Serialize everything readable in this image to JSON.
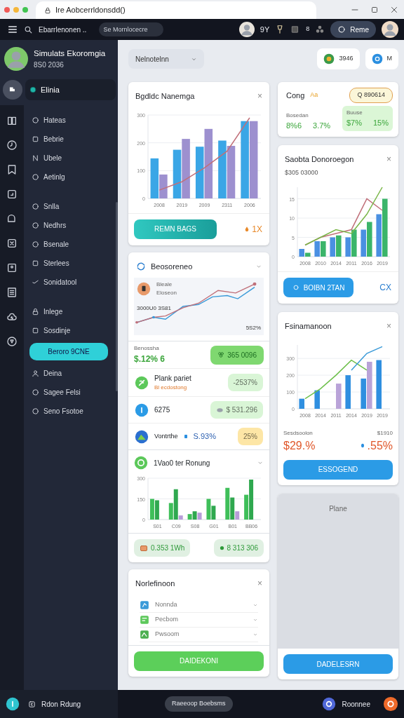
{
  "browser": {
    "tab_title": "Ire Aobcerrldonsdd()"
  },
  "topbar": {
    "search_label": "Ebarrlenonen ..",
    "search": {
      "placeholder": "Se Mornlocecre"
    },
    "counter": "9Y",
    "badge": "8",
    "account_button": "Reme"
  },
  "profile": {
    "name": "Simulats Ekoromgia",
    "subtitle": "8S0 2036"
  },
  "nav_header": {
    "label": "Elinia",
    "selected": true
  },
  "sidebar": {
    "groups": [
      {
        "items": [
          {
            "label": "Hateas",
            "kind": "link",
            "selected": false
          },
          {
            "label": "Bebrie",
            "kind": "link",
            "selected": false
          },
          {
            "label": "Ubele",
            "kind": "link",
            "selected": false
          },
          {
            "label": "Aetinlg",
            "kind": "link",
            "selected": false
          }
        ]
      },
      {
        "items": [
          {
            "label": "Snlla",
            "kind": "link",
            "selected": false
          },
          {
            "label": "Nedhrs",
            "kind": "link",
            "selected": false
          },
          {
            "label": "Bsenale",
            "kind": "link",
            "selected": false
          },
          {
            "label": "Sterlees",
            "kind": "link",
            "selected": false
          },
          {
            "label": "Sonidatool",
            "kind": "link",
            "selected": false
          }
        ]
      },
      {
        "items": [
          {
            "label": "Inlege",
            "kind": "link",
            "selected": false
          },
          {
            "label": "Sosdinje",
            "kind": "link",
            "selected": false
          },
          {
            "label": "Beroro 9CNE",
            "kind": "button",
            "selected": false
          },
          {
            "label": "Deina",
            "kind": "link",
            "selected": false
          },
          {
            "label": "Sagee Felsi",
            "kind": "link",
            "selected": false
          },
          {
            "label": "Seno Fsotoe",
            "kind": "link",
            "selected": false
          }
        ]
      }
    ]
  },
  "filter": {
    "value": "Nelnotelnn"
  },
  "chips": [
    {
      "label": "3946"
    },
    {
      "label": "M"
    }
  ],
  "column_1": [
    {
      "kind": "chart",
      "title": "Bgdldc Nanemga",
      "close": "×",
      "chart_data": {
        "type": "bar",
        "grid": true,
        "categories": [
          "2008",
          "2019",
          "2009",
          "2311",
          "2006"
        ],
        "ylim": [
          0,
          300
        ],
        "yticks": [
          0,
          100,
          200,
          300
        ],
        "series": [
          {
            "type": "bar",
            "color": "#3aa6e6",
            "values": [
              144,
              175,
              186,
              208,
              278
            ]
          },
          {
            "type": "bar",
            "color": "#9d90cf",
            "values": [
              86,
              214,
              250,
              189,
              278
            ]
          },
          {
            "type": "line",
            "color": "#c0707a",
            "values": [
              30,
              60,
              110,
              170,
              290
            ]
          }
        ]
      },
      "button": {
        "label": "REMN BAGS",
        "kind": "teal"
      },
      "aside": {
        "text": "1X",
        "color": "#e8892a",
        "icon": true
      }
    },
    {
      "kind": "feed",
      "title": "Beosoreneo",
      "expanded": true,
      "trend": {
        "label": "Bleale",
        "sublabel": "Eloseon",
        "reading": "3000U0 3S81",
        "corner": "5S2%"
      },
      "summary": {
        "label": "Benossha",
        "value": "$.12% 6",
        "pill": "365 0096"
      },
      "rows": [
        {
          "kind": "double",
          "title": "Plank pariet",
          "subtitle": "Bl ecdostong",
          "pill": "-2537%",
          "color": "#d9f5d6"
        },
        {
          "kind": "single",
          "title": "6275",
          "pill": "$ 531.296",
          "color": "#d9f5d6"
        },
        {
          "kind": "inline",
          "title": "Vontrthe",
          "value": "S.93%",
          "pill": "25%",
          "color": "#fde6a6"
        }
      ],
      "section": {
        "title": "1Vao0 ter Ronung",
        "expanded": true,
        "chart_data": {
          "type": "bar",
          "grid": true,
          "categories": [
            "S01",
            "C09",
            "S08",
            "G01",
            "B01",
            "BB06"
          ],
          "ylim": [
            0,
            300
          ],
          "yticks": [
            0,
            150,
            300
          ],
          "series": [
            {
              "type": "bar",
              "color": "#3fbf5a",
              "values": [
                150,
                120,
                40,
                150,
                230,
                180
              ]
            },
            {
              "type": "bar",
              "color": "#2fa84f",
              "values": [
                140,
                220,
                60,
                100,
                160,
                290
              ]
            },
            {
              "type": "bar",
              "color": "#b79cd8",
              "values": [
                null,
                30,
                50,
                null,
                60,
                null
              ]
            }
          ]
        },
        "pills": [
          "0.353 1Wh",
          "8 313 306"
        ]
      }
    },
    {
      "kind": "list",
      "title": "Norlefinoon",
      "close": "×",
      "items": [
        {
          "label": "Nonnda"
        },
        {
          "label": "Pecbom"
        },
        {
          "label": "Pwsoom"
        }
      ],
      "button": {
        "label": "DAIDEKONI",
        "kind": "green"
      }
    }
  ],
  "column_2": [
    {
      "kind": "stats",
      "title": "Cong",
      "tag": "Aa",
      "badge": "Q 890614",
      "left": {
        "label": "Bosedan",
        "values": [
          "8%6",
          "3.7%"
        ]
      },
      "right": {
        "label": "Buuse",
        "values": [
          "$7%",
          "15%"
        ]
      }
    },
    {
      "kind": "chart",
      "title": "Saobta Donoroegon",
      "subtitle": "$305 03000",
      "close": "×",
      "chart_data": {
        "type": "bar",
        "grid": true,
        "categories": [
          "2008",
          "2010",
          "2014",
          "2011",
          "2016",
          "2019"
        ],
        "ylim": [
          0,
          18
        ],
        "yticks": [
          0,
          5,
          10,
          15
        ],
        "series": [
          {
            "type": "bar",
            "color": "#4a90e2",
            "values": [
              2,
              4,
              5,
              5,
              7,
              11
            ]
          },
          {
            "type": "bar",
            "color": "#3bb56a",
            "values": [
              1,
              4,
              5.5,
              7,
              9,
              15
            ]
          },
          {
            "type": "line",
            "color": "#c0707a",
            "values": [
              3,
              5,
              6,
              7,
              15,
              12
            ]
          },
          {
            "type": "line",
            "color": "#7ab648",
            "values": [
              3,
              5,
              7,
              6,
              11,
              18
            ]
          }
        ]
      },
      "button": {
        "label": "BOIBN 2TAN",
        "kind": "blue"
      },
      "aside": {
        "text": "CX",
        "color": "#2b7fd0"
      }
    },
    {
      "kind": "chart",
      "title": "Fsinamanoon",
      "close": "×",
      "chart_data": {
        "type": "bar",
        "grid": true,
        "categories": [
          "2008",
          "2014",
          "2011",
          "2014",
          "2019",
          "2019"
        ],
        "ylim": [
          0,
          380
        ],
        "yticks": [
          0,
          100,
          200,
          300
        ],
        "series": [
          {
            "type": "bar",
            "color": "#2f8fe0",
            "values": [
              60,
              110,
              null,
              200,
              180,
              290
            ]
          },
          {
            "type": "bar",
            "color": "#b9a3d8",
            "values": [
              null,
              null,
              150,
              null,
              280,
              null
            ]
          },
          {
            "type": "line",
            "color": "#6cbf4a",
            "values": [
              60,
              120,
              200,
              290,
              230,
              null
            ]
          },
          {
            "type": "line",
            "color": "#3a9ad8",
            "values": [
              null,
              null,
              null,
              230,
              330,
              370
            ]
          }
        ]
      },
      "stats": {
        "left_label": "Sesdsoolon",
        "left_value": "$29.%",
        "right_label": "$1910",
        "right_value": ".55%"
      },
      "button": {
        "label": "ESSOGEND",
        "kind": "blue"
      }
    },
    {
      "kind": "placeholder",
      "title": "Plane",
      "button": {
        "label": "DADELESRN",
        "kind": "blue"
      }
    }
  ],
  "bottom_bar": {
    "left_label": "Rdon Rdung",
    "center_pill": "Raeeoop Boebsms",
    "right_label": "Roonnee"
  }
}
